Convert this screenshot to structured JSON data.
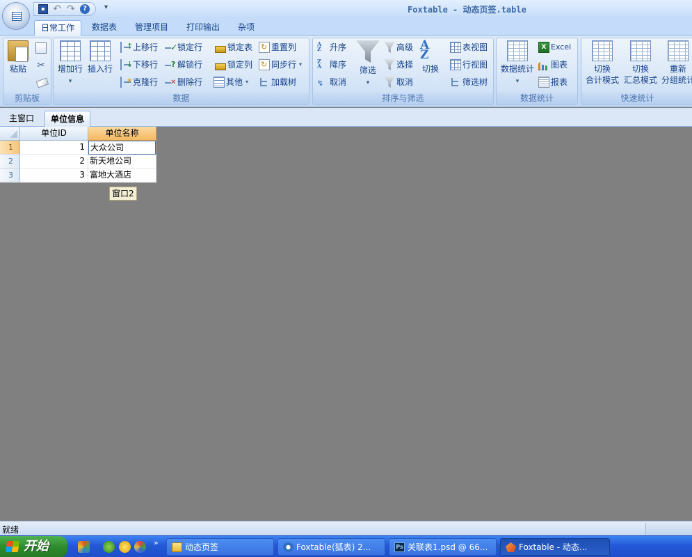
{
  "app": {
    "window_title": "Foxtable - 动态页签.table"
  },
  "quick_access": {
    "more": "▾"
  },
  "ribbon_tabs": [
    {
      "label": "日常工作",
      "active": true
    },
    {
      "label": "数据表"
    },
    {
      "label": "管理项目"
    },
    {
      "label": "打印输出"
    },
    {
      "label": "杂项"
    }
  ],
  "groups": {
    "clipboard": {
      "label": "剪贴板",
      "paste": "粘贴"
    },
    "data": {
      "label": "数据",
      "add_row": "增加行",
      "insert_row": "插入行",
      "move_up": "上移行",
      "move_down": "下移行",
      "clone_row": "克隆行",
      "lock_row": "锁定行",
      "unlock_row": "解锁行",
      "delete_row": "删除行",
      "lock_table": "锁定表",
      "lock_col": "锁定列",
      "other": "其他",
      "reset_col": "重置列",
      "sync_row": "同步行",
      "load_tree": "加载树"
    },
    "sort_filter": {
      "label": "排序与筛选",
      "asc": "升序",
      "desc": "降序",
      "cancel": "取消",
      "filter": "筛选",
      "advanced": "高级",
      "select": "选择",
      "cancel_filter": "取消",
      "toggle": "切换",
      "table_view": "表视图",
      "row_view": "行视图",
      "filter_tree": "筛选树"
    },
    "stats": {
      "label": "数据统计",
      "stats": "数据统计",
      "excel": "Excel",
      "chart": "图表",
      "report": "报表"
    },
    "quick_stats": {
      "label": "快速统计",
      "btn1_line1": "切换",
      "btn1_line2": "合计模式",
      "btn2_line1": "切换",
      "btn2_line2": "汇总模式",
      "btn3_line1": "重新",
      "btn3_line2": "分组统计"
    }
  },
  "doc_tabs": [
    {
      "label": "主窗口"
    },
    {
      "label": "单位信息",
      "active": true
    }
  ],
  "grid": {
    "columns": [
      "单位ID",
      "单位名称"
    ],
    "rows": [
      {
        "num": "1",
        "id": "1",
        "name": "大众公司"
      },
      {
        "num": "2",
        "id": "2",
        "name": "新天地公司"
      },
      {
        "num": "3",
        "id": "3",
        "name": "富地大酒店"
      }
    ]
  },
  "tooltip": "窗口2",
  "status": {
    "text": "就绪"
  },
  "taskbar": {
    "start": "开始",
    "more": "»",
    "buttons": [
      {
        "label": "动态页签"
      },
      {
        "label": "Foxtable(狐表) 2..."
      },
      {
        "label": "关联表1.psd @ 66..."
      },
      {
        "label": "Foxtable - 动态..."
      }
    ]
  }
}
